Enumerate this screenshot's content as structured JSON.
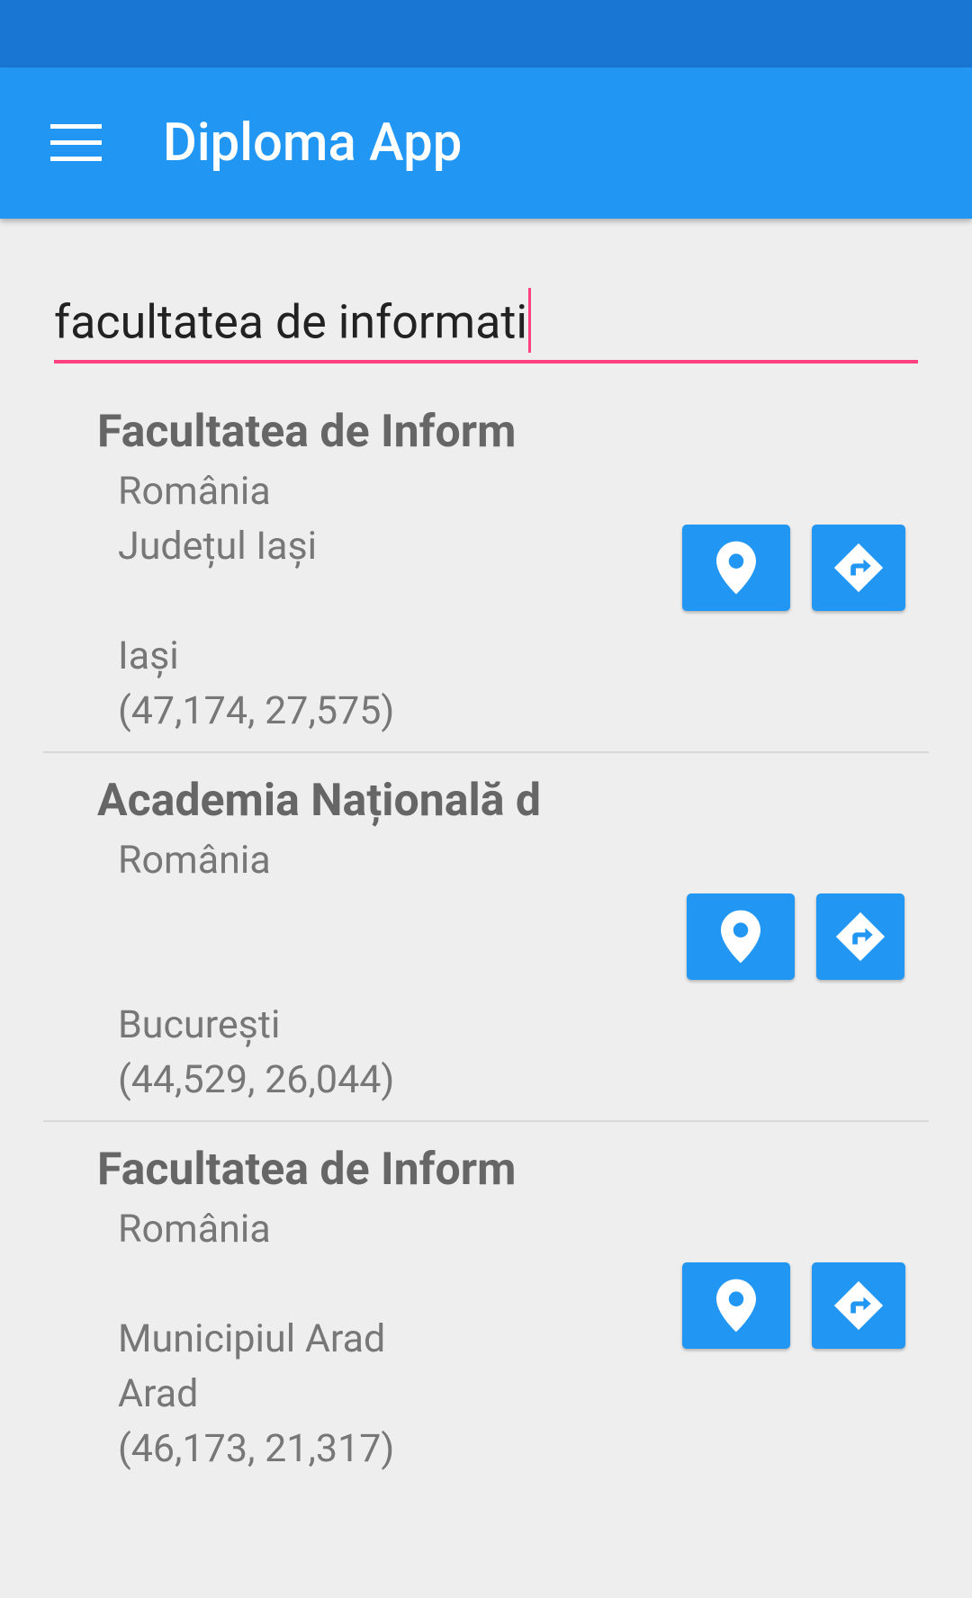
{
  "app_bar": {
    "title": "Diploma App",
    "menu_icon": "hamburger-menu-icon",
    "background": "#2196f3",
    "status_bar_color": "#1976d2"
  },
  "search": {
    "value": "facultatea de informati",
    "accent_color": "#ff4081"
  },
  "results": [
    {
      "title": "Facultatea de Inform",
      "country": "România",
      "region": "Județul Iași",
      "extra": "",
      "city": "Iași",
      "coords": "(47,174, 27,575)"
    },
    {
      "title": "Academia Națională d",
      "country": "România",
      "region": "",
      "extra": "",
      "city": "București",
      "coords": "(44,529, 26,044)"
    },
    {
      "title": "Facultatea de Inform",
      "country": "România",
      "region": "",
      "extra": "Municipiul Arad",
      "city": "Arad",
      "coords": "(46,173, 21,317)"
    }
  ],
  "buttons": {
    "location_icon": "map-marker-icon",
    "directions_icon": "directions-icon"
  }
}
